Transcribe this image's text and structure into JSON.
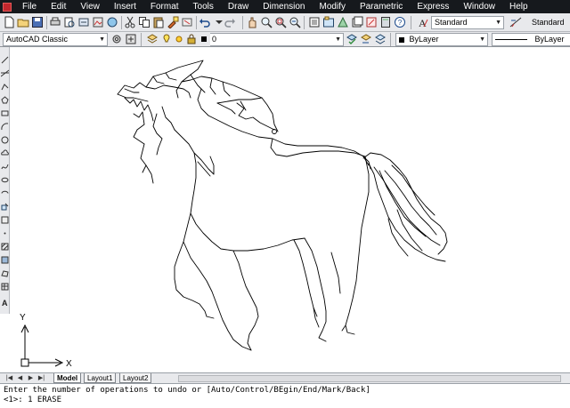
{
  "menu": {
    "items": [
      "File",
      "Edit",
      "View",
      "Insert",
      "Format",
      "Tools",
      "Draw",
      "Dimension",
      "Modify",
      "Parametric",
      "Express",
      "Window",
      "Help"
    ]
  },
  "toolbar_top": {
    "text_style": "Standard",
    "dim_style": "Standard"
  },
  "toolbar_layers": {
    "workspace": "AutoCAD Classic",
    "current_layer": "0",
    "color_control": "ByLayer",
    "linetype_control": "ByLayer"
  },
  "ucs": {
    "x_label": "X",
    "y_label": "Y"
  },
  "tabs": {
    "model": "Model",
    "layout1": "Layout1",
    "layout2": "Layout2"
  },
  "command_line": {
    "prompt_line": "Enter the number of operations to undo or [Auto/Control/BEgin/End/Mark/Back]",
    "history_line": "<1>: 1 ERASE"
  },
  "icons": {
    "toolbar": [
      "new-icon",
      "open-icon",
      "save-icon",
      "print-icon",
      "print-preview-icon",
      "publish-icon",
      "cut-icon",
      "copy-icon",
      "paste-icon",
      "match-properties-icon",
      "undo-icon",
      "redo-icon",
      "pan-icon",
      "zoom-realtime-icon",
      "zoom-window-icon",
      "zoom-previous-icon",
      "properties-icon",
      "design-center-icon",
      "tool-palettes-icon",
      "sheet-set-icon",
      "markup-icon",
      "calculator-icon",
      "help-icon",
      "text-style-icon",
      "dim-style-icon"
    ],
    "layers": [
      "workspace-settings-icon",
      "layer-manager-icon",
      "layer-state-icon",
      "make-current-icon",
      "layer-previous-icon"
    ],
    "draw": [
      "line-icon",
      "construction-line-icon",
      "polyline-icon",
      "polygon-icon",
      "rectangle-icon",
      "arc-icon",
      "circle-icon",
      "revision-cloud-icon",
      "spline-icon",
      "ellipse-icon",
      "ellipse-arc-icon",
      "insert-block-icon",
      "make-block-icon",
      "point-icon",
      "hatch-icon",
      "gradient-icon",
      "region-icon",
      "table-icon",
      "multiline-text-icon"
    ]
  }
}
